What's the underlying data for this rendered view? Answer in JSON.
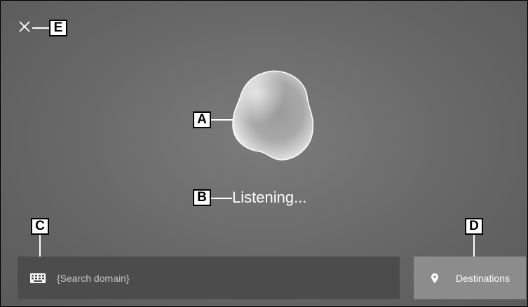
{
  "callouts": {
    "a": "A",
    "b": "B",
    "c": "C",
    "d": "D",
    "e": "E"
  },
  "voice": {
    "status": "Listening..."
  },
  "search": {
    "placeholder": "{Search domain}"
  },
  "destinations": {
    "label": "Destinations"
  },
  "icons": {
    "close": "close-icon",
    "keyboard": "keyboard-icon",
    "pin": "location-pin-icon"
  },
  "colors": {
    "background": "#676767",
    "search_bar": "#4c4c4c",
    "destinations_button": "#8c8c8c"
  }
}
